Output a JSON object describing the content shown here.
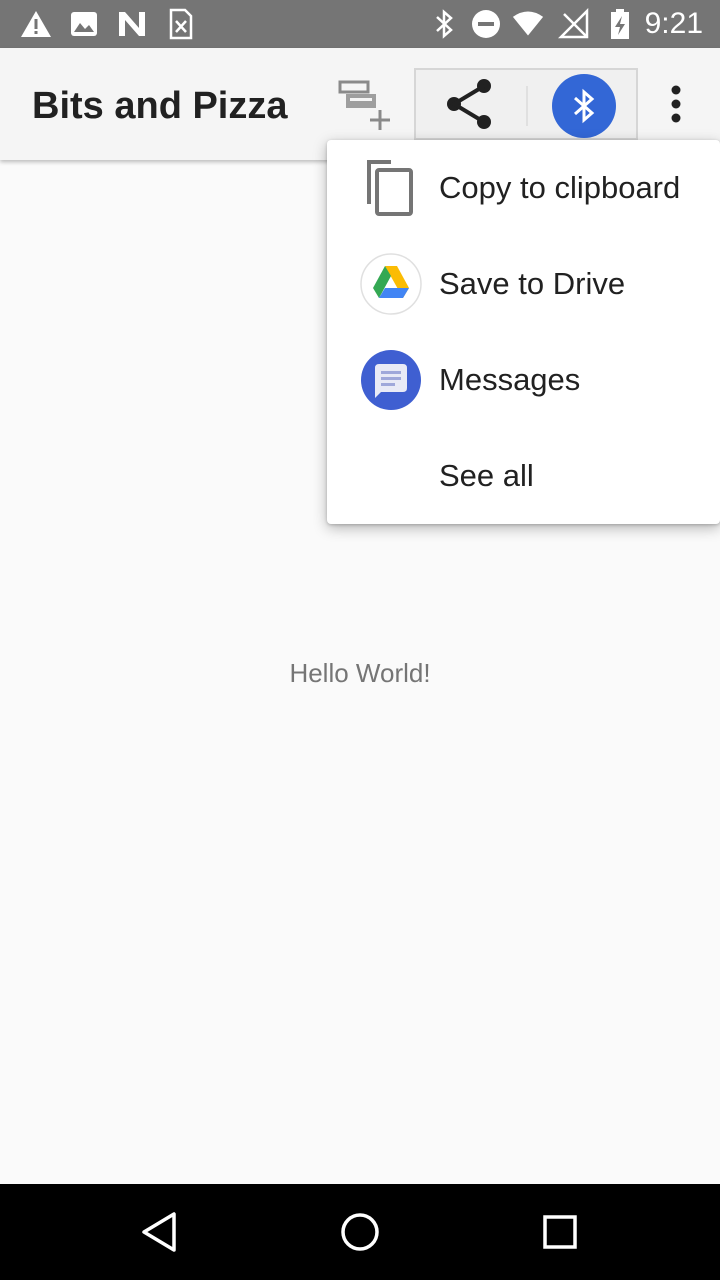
{
  "status_bar": {
    "time": "9:21",
    "left_icons": [
      "warning-icon",
      "image-icon",
      "n-logo-icon",
      "sim-icon"
    ],
    "right_icons": [
      "bluetooth-icon",
      "do-not-disturb-icon",
      "wifi-icon",
      "no-signal-icon",
      "battery-charging-icon"
    ]
  },
  "app_bar": {
    "title": "Bits and Pizza",
    "actions": [
      "create-order-icon",
      "share-icon",
      "bluetooth-share-icon",
      "more-vert-icon"
    ]
  },
  "share_menu": {
    "items": [
      {
        "label": "Copy to clipboard",
        "icon": "copy-icon"
      },
      {
        "label": "Save to Drive",
        "icon": "drive-icon"
      },
      {
        "label": "Messages",
        "icon": "messages-icon"
      },
      {
        "label": "See all",
        "icon": ""
      }
    ]
  },
  "content": {
    "text": "Hello World!"
  },
  "nav_bar": {
    "buttons": [
      "back-icon",
      "home-icon",
      "recents-icon"
    ]
  },
  "colors": {
    "status_bar": "#757575",
    "app_bar": "#f5f5f5",
    "background": "#fafafa",
    "bluetooth_blue": "#3367d6",
    "messages_blue": "#3f5fd1"
  }
}
